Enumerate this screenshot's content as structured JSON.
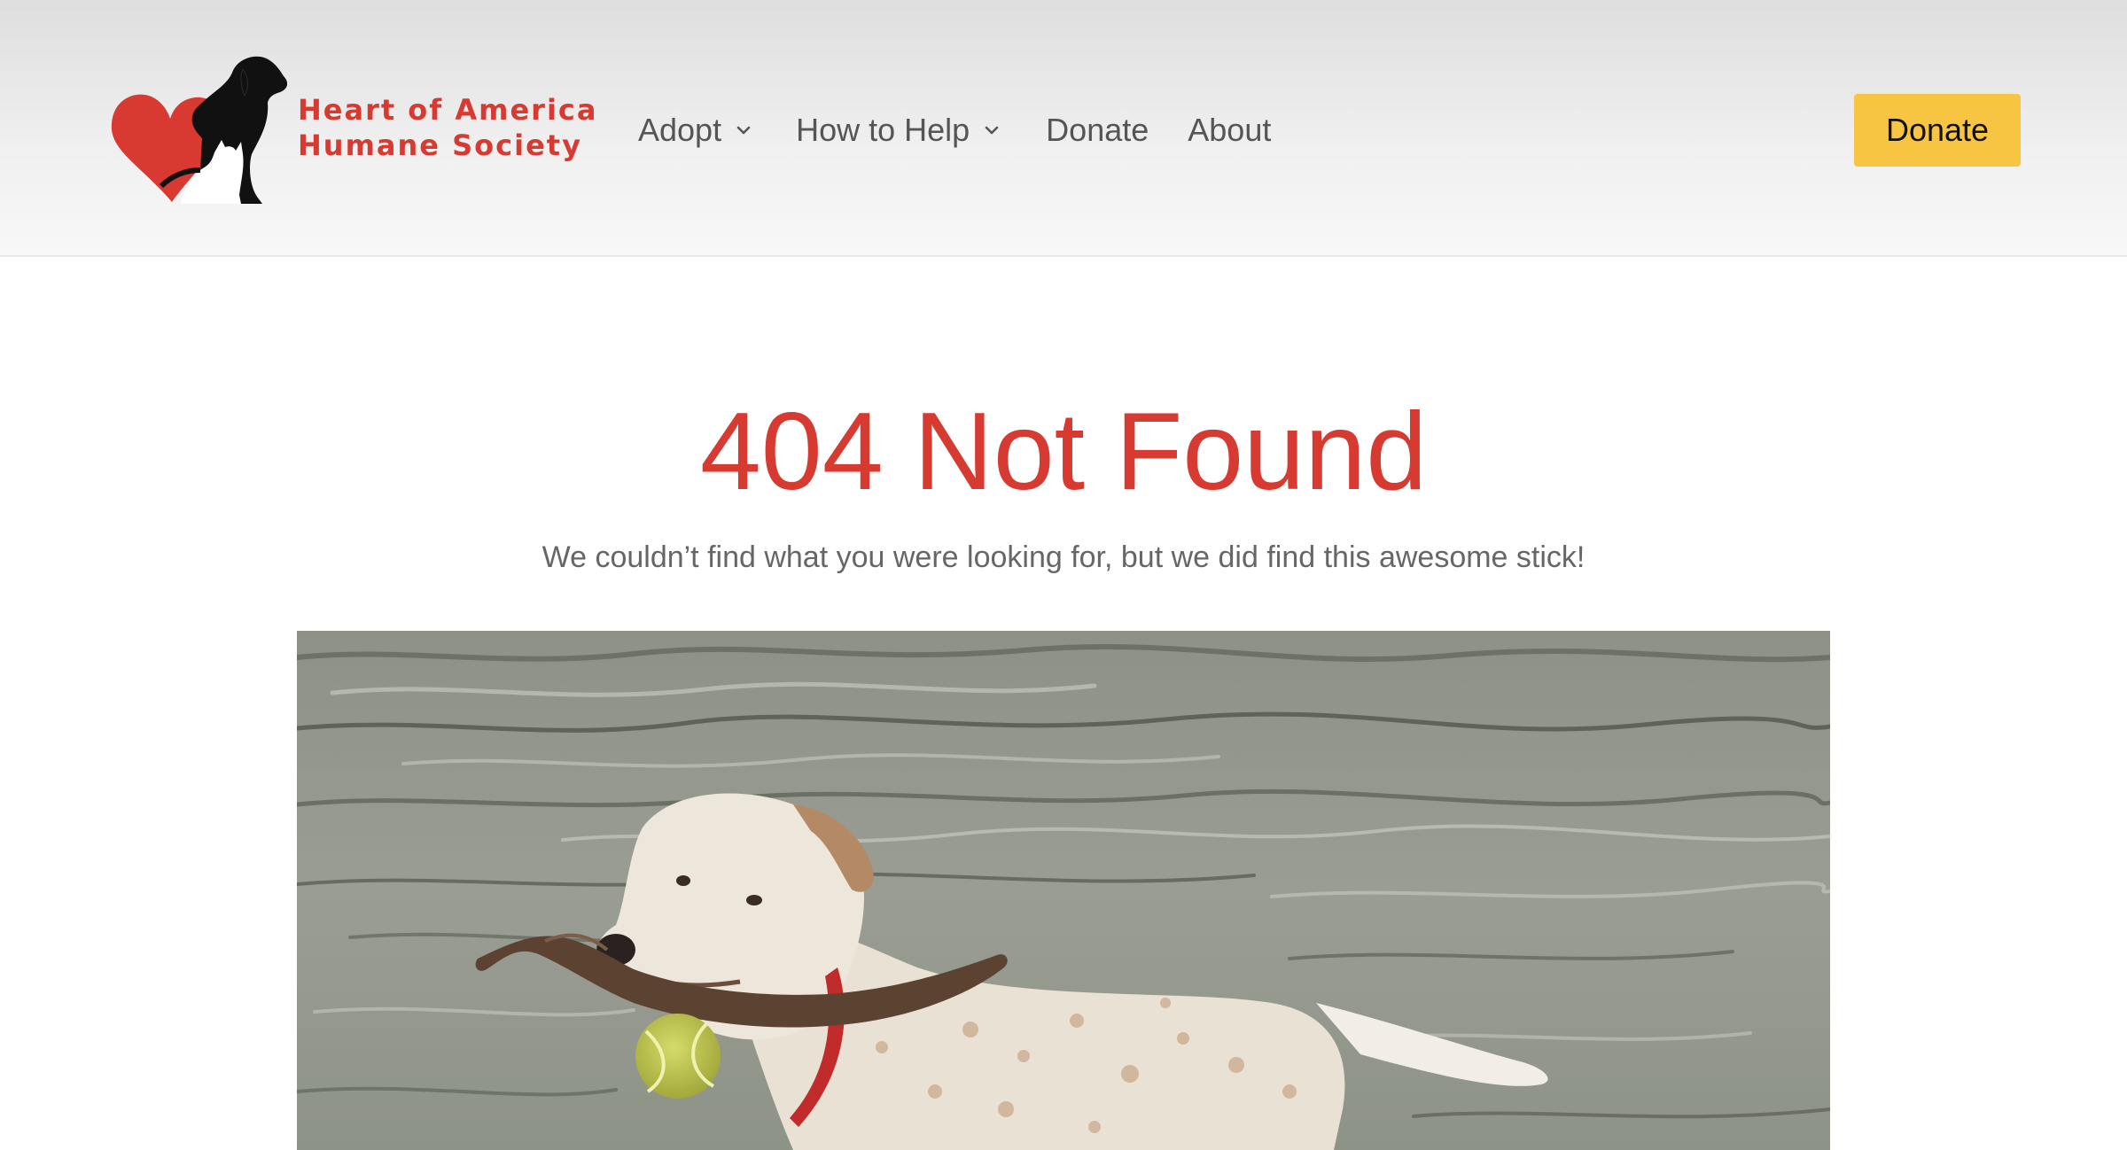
{
  "header": {
    "brand_line1": "Heart of America",
    "brand_line2": "Humane Society",
    "nav": [
      {
        "label": "Adopt",
        "has_dropdown": true
      },
      {
        "label": "How to Help",
        "has_dropdown": true
      },
      {
        "label": "Donate",
        "has_dropdown": false
      },
      {
        "label": "About",
        "has_dropdown": false
      }
    ],
    "cta_label": "Donate"
  },
  "main": {
    "title": "404 Not Found",
    "subtitle": "We couldn’t find what you were looking for, but we did find this awesome stick!"
  },
  "colors": {
    "brand_red": "#d63a31",
    "cta_yellow": "#f8c543",
    "nav_text": "#555555",
    "subtitle_text": "#666666"
  },
  "icons": [
    "heart-dog-cat-logo",
    "chevron-down-icon"
  ]
}
